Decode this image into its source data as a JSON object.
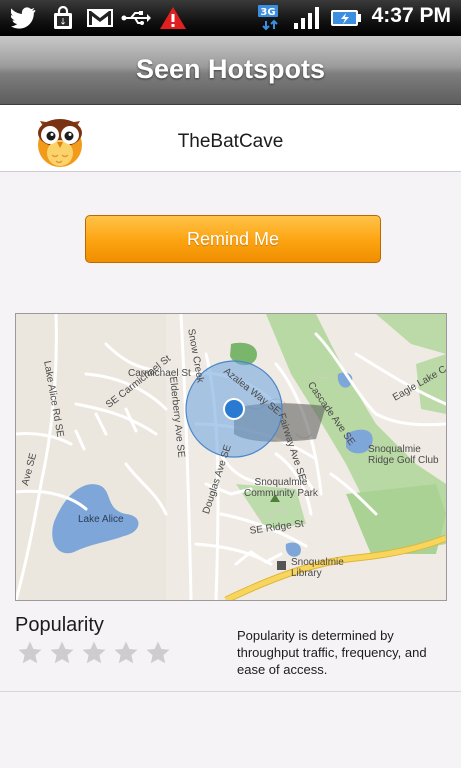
{
  "status_bar": {
    "time": "4:37 PM",
    "network": "3G",
    "icons": [
      "twitter-icon",
      "shopping-bag-icon",
      "gmail-icon",
      "usb-icon",
      "warning-icon",
      "network-3g-icon",
      "signal-icon",
      "battery-icon"
    ]
  },
  "header": {
    "title": "Seen Hotspots"
  },
  "hotspot": {
    "name": "TheBatCave",
    "avatar_icon": "owl-icon"
  },
  "remind_button": {
    "label": "Remind Me",
    "color": "#fda614"
  },
  "map": {
    "labels": {
      "lake_alice_rd": "Lake Alice Rd SE",
      "carmichael": "SE Carmichael St",
      "carmichael_st": "Carmichael St",
      "snow_creek": "Snow Creek",
      "azalea": "Azalea Way SE",
      "elderberry": "Elderberry Ave SE",
      "ave_se": "Ave SE",
      "cascade": "Cascade Ave SE",
      "fairway": "Fairway Ave SE",
      "eagle_lake": "Eagle Lake C",
      "lake_alice": "Lake Alice",
      "community_park": "Snoqualmie\nCommunity Park",
      "golf_club": "Snoqualmie\nRidge Golf Club",
      "douglas": "Douglas Ave SE",
      "ridge_st": "SE Ridge St",
      "library": "Snoqualmie\nLibrary"
    },
    "colors": {
      "water": "#7ea6d8",
      "park": "#b8d9a3",
      "road": "#ffffff",
      "highway": "#f7d25a",
      "accuracy_circle": "#6aa2de"
    }
  },
  "popularity": {
    "label": "Popularity",
    "rating": 0,
    "max_rating": 5,
    "description": "Popularity is determined by throughput traffic, frequency, and ease of access."
  }
}
